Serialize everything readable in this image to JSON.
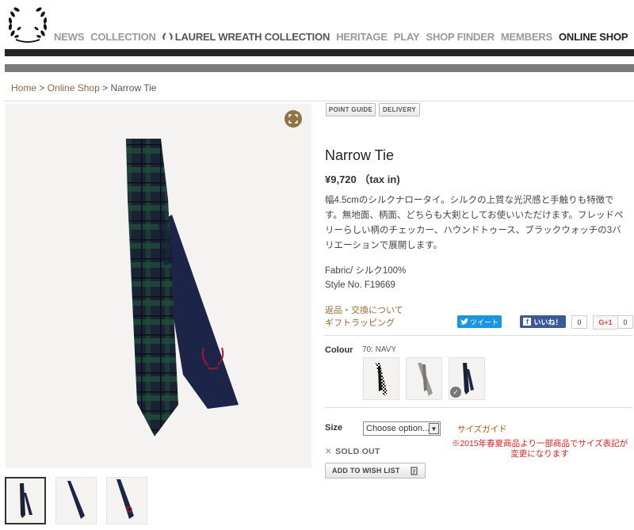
{
  "nav": {
    "items": [
      "NEWS",
      "COLLECTION",
      "LAUREL WREATH COLLECTION",
      "HERITAGE",
      "PLAY",
      "SHOP FINDER",
      "MEMBERS",
      "ONLINE SHOP"
    ]
  },
  "breadcrumb": {
    "home": "Home",
    "shop": "Online Shop",
    "current": "Narrow Tie",
    "separator": ">"
  },
  "tags": {
    "point_guide": "POINT GUIDE",
    "delivery": "DELIVERY"
  },
  "product": {
    "title": "Narrow Tie",
    "price": "¥9,720 （tax in)",
    "description": "幅4.5cmのシルクナロータイ。シルクの上質な光沢感と手触りも特徴です。無地面、柄面、どちらも大剣としてお使いいただけます。フレッドペリーらしい柄のチェッカー、ハウンドトゥース、ブラックウォッチの3バリエーションで展開します。",
    "fabric": "Fabric/ シルク100%",
    "style_no": "Style No. F19669"
  },
  "links": {
    "returns": "返品・交換について",
    "gift": "ギフトラッピング"
  },
  "social": {
    "tweet": "ツイート",
    "like": "いいね！",
    "like_count": "0",
    "gplus": "G+1",
    "gplus_count": "0"
  },
  "colour": {
    "label": "Colour",
    "value": "70: NAVY"
  },
  "size": {
    "label": "Size",
    "selected": "Choose option...",
    "guide": "サイズガイド",
    "note": "※2015年春夏商品より一部商品でサイズ表記が変更になります"
  },
  "stock": {
    "sold_out": "SOLD OUT"
  },
  "wishlist": {
    "label": "ADD TO WISH LIST"
  },
  "colors": {
    "accent": "#8f7443",
    "nav_active": "#222222",
    "nav": "#999999",
    "bar_dark": "#262626",
    "bar_grey": "#7a7a7a",
    "red_note": "#e02020"
  }
}
